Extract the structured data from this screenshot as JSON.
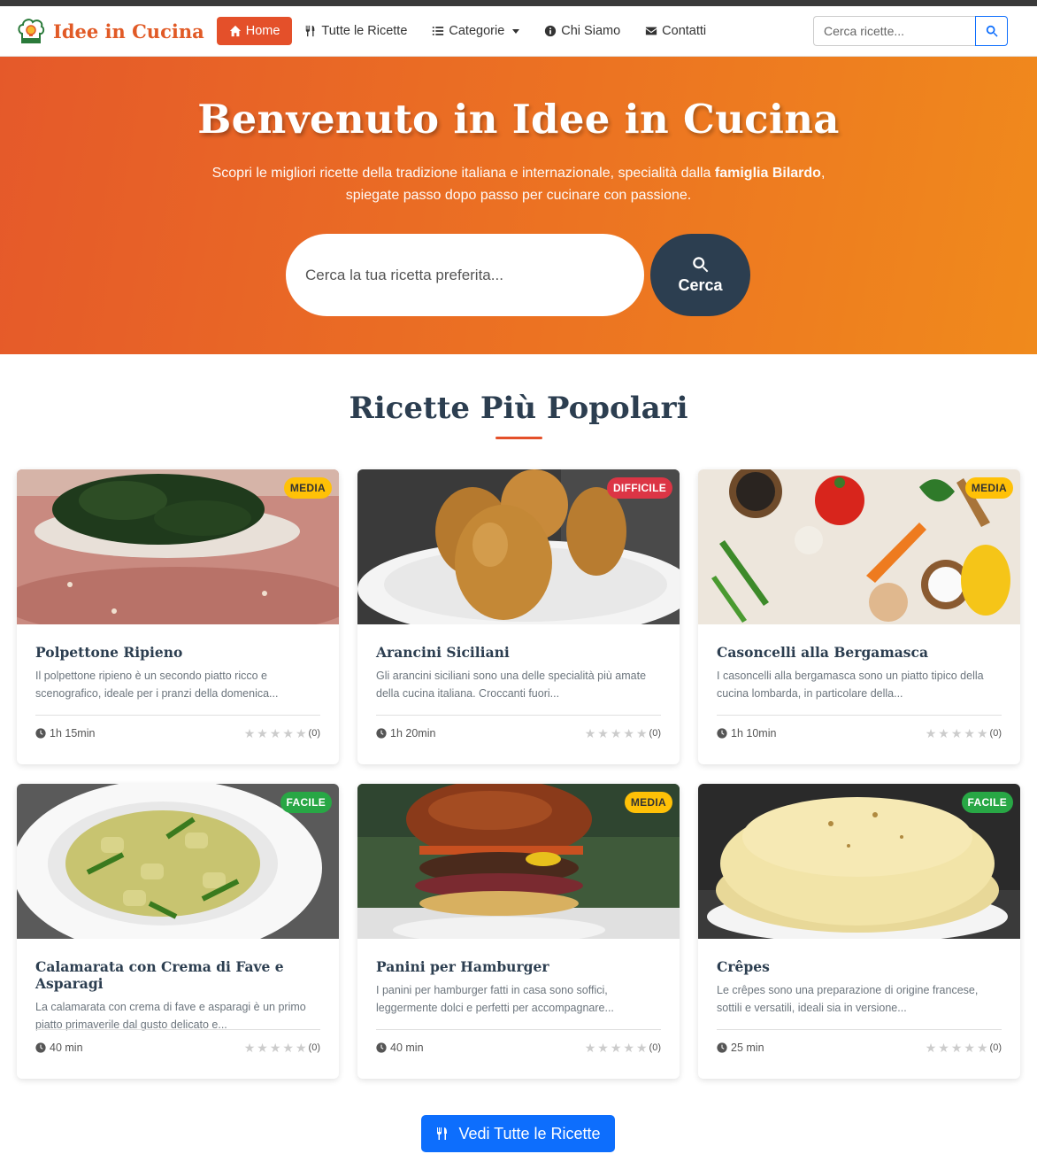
{
  "brand": {
    "name": "Idee in Cucina"
  },
  "nav": {
    "items": [
      {
        "label": "Home",
        "icon": "home-icon"
      },
      {
        "label": "Tutte le Ricette",
        "icon": "utensils-icon"
      },
      {
        "label": "Categorie",
        "icon": "list-icon"
      },
      {
        "label": "Chi Siamo",
        "icon": "info-icon"
      },
      {
        "label": "Contatti",
        "icon": "envelope-icon"
      }
    ],
    "search_placeholder": "Cerca ricette..."
  },
  "hero": {
    "title": "Benvenuto in Idee in Cucina",
    "subtitle_pre": "Scopri le migliori ricette della tradizione italiana e internazionale, specialità dalla ",
    "subtitle_bold": "famiglia Bilardo",
    "subtitle_post": ",",
    "subtitle_line2": "spiegate passo dopo passo per cucinare con passione.",
    "search_placeholder": "Cerca la tua ricetta preferita...",
    "search_button": "Cerca"
  },
  "section": {
    "title": "Ricette Più Popolari"
  },
  "recipes": [
    {
      "title": "Polpettone Ripieno",
      "badge": "MEDIA",
      "level": "media",
      "desc_line1": "Il polpettone ripieno è un secondo piatto ricco e",
      "desc_line2": "scenografico, ideale per i pranzi della domenica...",
      "time": "1h 15min",
      "rating_count": "(0)",
      "image": "polpettone"
    },
    {
      "title": "Arancini Siciliani",
      "badge": "DIFFICILE",
      "level": "difficile",
      "desc_line1": "Gli arancini siciliani sono una delle specialità più amate",
      "desc_line2": "della cucina italiana. Croccanti fuori...",
      "time": "1h 20min",
      "rating_count": "(0)",
      "image": "arancini"
    },
    {
      "title": "Casoncelli alla Bergamasca",
      "badge": "MEDIA",
      "level": "media",
      "desc_line1": "I casoncelli alla bergamasca sono un piatto tipico della",
      "desc_line2": "cucina lombarda, in particolare della...",
      "time": "1h 10min",
      "rating_count": "(0)",
      "image": "ingredienti"
    },
    {
      "title": "Calamarata con Crema di Fave e Asparagi",
      "badge": "FACILE",
      "level": "facile",
      "desc_line1": "La calamarata con crema di fave e asparagi è un primo",
      "desc_line2": "piatto primaverile dal gusto delicato e...",
      "time": "40 min",
      "rating_count": "(0)",
      "image": "calamarata"
    },
    {
      "title": "Panini per Hamburger",
      "badge": "MEDIA",
      "level": "media",
      "desc_line1": "I panini per hamburger fatti in casa sono soffici,",
      "desc_line2": "leggermente dolci e perfetti per accompagnare...",
      "time": "40 min",
      "rating_count": "(0)",
      "image": "hamburger"
    },
    {
      "title": "Crêpes",
      "badge": "FACILE",
      "level": "facile",
      "desc_line1": "Le crêpes sono una preparazione di origine francese,",
      "desc_line2": "sottili e versatili, ideali sia in versione...",
      "time": "25 min",
      "rating_count": "(0)",
      "image": "crepes"
    }
  ],
  "cta": {
    "label": "Vedi Tutte le Ricette"
  },
  "colors": {
    "primary": "#e4502a",
    "dark": "#2c3e50",
    "blue": "#0d6efd"
  }
}
